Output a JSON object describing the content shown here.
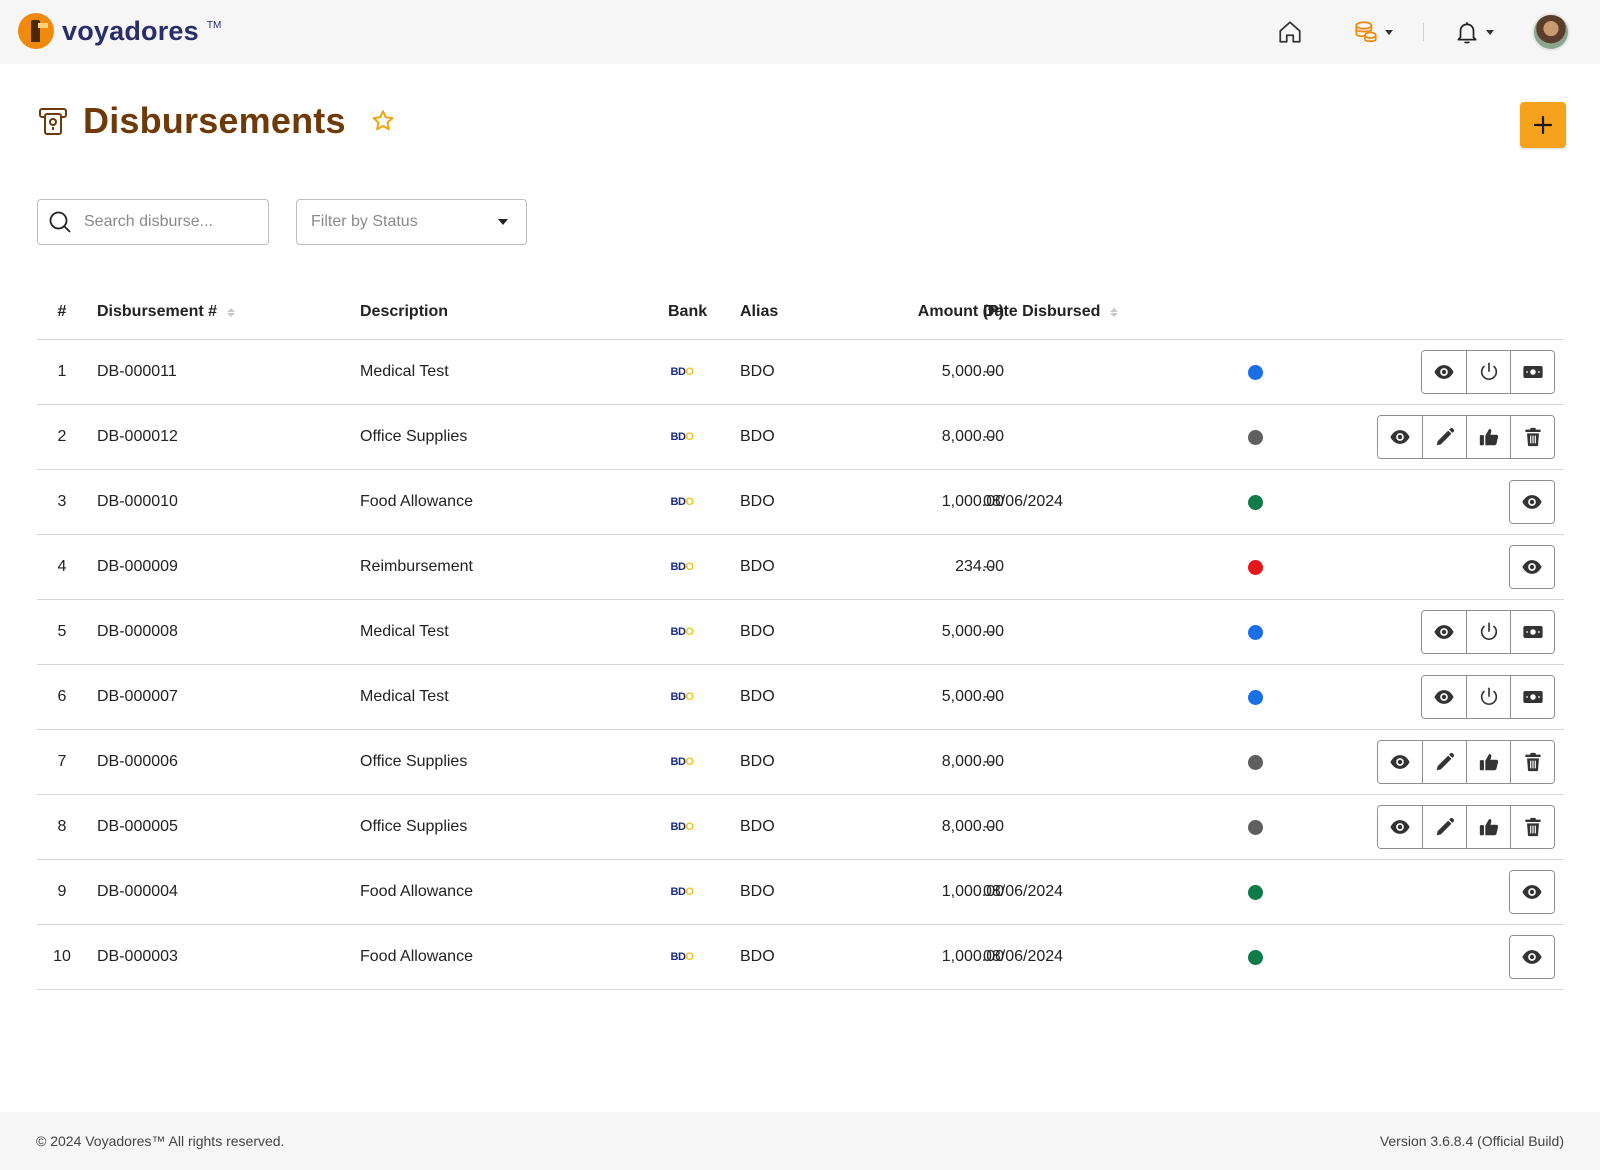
{
  "app": {
    "brand_name": "voyadores",
    "brand_tm": "TM"
  },
  "header": {
    "icons": [
      "home-icon",
      "coins-icon",
      "bell-icon",
      "avatar"
    ]
  },
  "page": {
    "title": "Disbursements",
    "add_label": "+"
  },
  "filters": {
    "search_placeholder": "Search disburse...",
    "status_placeholder": "Filter by Status"
  },
  "table": {
    "columns": {
      "num": "#",
      "id": "Disbursement #",
      "description": "Description",
      "bank": "Bank",
      "alias": "Alias",
      "amount": "Amount (₱)",
      "date": "Date Disbursed"
    },
    "status_colors": {
      "blue": "#1a6fe6",
      "gray": "#5f5f5f",
      "green": "#0f7a4a",
      "red": "#e3161b"
    },
    "rows": [
      {
        "num": "1",
        "id": "DB-000011",
        "description": "Medical Test",
        "bank_logo": "BDO",
        "alias": "BDO",
        "amount": "5,000.00",
        "date": "--",
        "status": "blue",
        "actions": [
          "view",
          "power",
          "cash"
        ]
      },
      {
        "num": "2",
        "id": "DB-000012",
        "description": "Office Supplies",
        "bank_logo": "BDO",
        "alias": "BDO",
        "amount": "8,000.00",
        "date": "--",
        "status": "gray",
        "actions": [
          "view",
          "edit",
          "approve",
          "delete"
        ]
      },
      {
        "num": "3",
        "id": "DB-000010",
        "description": "Food Allowance",
        "bank_logo": "BDO",
        "alias": "BDO",
        "amount": "1,000.00",
        "date": "08/06/2024",
        "status": "green",
        "actions": [
          "view"
        ]
      },
      {
        "num": "4",
        "id": "DB-000009",
        "description": "Reimbursement",
        "bank_logo": "BDO",
        "alias": "BDO",
        "amount": "234.00",
        "date": "--",
        "status": "red",
        "actions": [
          "view"
        ]
      },
      {
        "num": "5",
        "id": "DB-000008",
        "description": "Medical Test",
        "bank_logo": "BDO",
        "alias": "BDO",
        "amount": "5,000.00",
        "date": "--",
        "status": "blue",
        "actions": [
          "view",
          "power",
          "cash"
        ]
      },
      {
        "num": "6",
        "id": "DB-000007",
        "description": "Medical Test",
        "bank_logo": "BDO",
        "alias": "BDO",
        "amount": "5,000.00",
        "date": "--",
        "status": "blue",
        "actions": [
          "view",
          "power",
          "cash"
        ]
      },
      {
        "num": "7",
        "id": "DB-000006",
        "description": "Office Supplies",
        "bank_logo": "BDO",
        "alias": "BDO",
        "amount": "8,000.00",
        "date": "--",
        "status": "gray",
        "actions": [
          "view",
          "edit",
          "approve",
          "delete"
        ]
      },
      {
        "num": "8",
        "id": "DB-000005",
        "description": "Office Supplies",
        "bank_logo": "BDO",
        "alias": "BDO",
        "amount": "8,000.00",
        "date": "--",
        "status": "gray",
        "actions": [
          "view",
          "edit",
          "approve",
          "delete"
        ]
      },
      {
        "num": "9",
        "id": "DB-000004",
        "description": "Food Allowance",
        "bank_logo": "BDO",
        "alias": "BDO",
        "amount": "1,000.00",
        "date": "08/06/2024",
        "status": "green",
        "actions": [
          "view"
        ]
      },
      {
        "num": "10",
        "id": "DB-000003",
        "description": "Food Allowance",
        "bank_logo": "BDO",
        "alias": "BDO",
        "amount": "1,000.00",
        "date": "08/06/2024",
        "status": "green",
        "actions": [
          "view"
        ]
      }
    ]
  },
  "footer": {
    "copyright": "© 2024 Voyadores™ All rights reserved.",
    "version": "Version 3.6.8.4 (Official Build)"
  }
}
